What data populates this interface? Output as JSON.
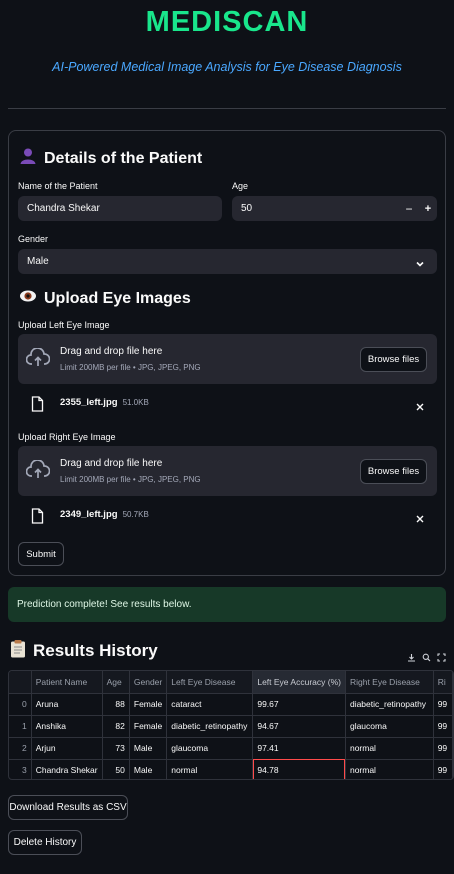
{
  "app": {
    "title": "MEDISCAN",
    "subtitle": "AI-Powered Medical Image Analysis for Eye Disease Diagnosis"
  },
  "patient": {
    "heading": "Details of the Patient",
    "name_label": "Name of the Patient",
    "name_value": "Chandra Shekar",
    "age_label": "Age",
    "age_value": "50",
    "age_minus": "−",
    "age_plus": "+",
    "gender_label": "Gender",
    "gender_value": "Male"
  },
  "upload": {
    "heading": "Upload Eye Images",
    "left_label": "Upload Left Eye Image",
    "right_label": "Upload Right Eye Image",
    "drag_text": "Drag and drop file here",
    "limit_text": "Limit 200MB per file • JPG, JPEG, PNG",
    "browse_label": "Browse files",
    "left_file": {
      "name": "2355_left.jpg",
      "size": "51.0KB"
    },
    "right_file": {
      "name": "2349_left.jpg",
      "size": "50.7KB"
    },
    "submit_label": "Submit"
  },
  "status": {
    "message": "Prediction complete! See results below."
  },
  "results": {
    "heading": "Results History",
    "columns": [
      "",
      "Patient Name",
      "Age",
      "Gender",
      "Left Eye Disease",
      "Left Eye Accuracy (%)",
      "Right Eye Disease",
      "Ri"
    ],
    "rows": [
      [
        "0",
        "Aruna",
        "88",
        "Female",
        "cataract",
        "99.67",
        "diabetic_retinopathy",
        "99"
      ],
      [
        "1",
        "Anshika",
        "82",
        "Female",
        "diabetic_retinopathy",
        "94.67",
        "glaucoma",
        "99"
      ],
      [
        "2",
        "Arjun",
        "73",
        "Male",
        "glaucoma",
        "97.41",
        "normal",
        "99"
      ],
      [
        "3",
        "Chandra Shekar",
        "50",
        "Male",
        "normal",
        "94.78",
        "normal",
        "99"
      ]
    ],
    "download_label": "Download Results as CSV",
    "delete_label": "Delete History"
  },
  "colors": {
    "title_green": "#19e68c",
    "subtitle_blue": "#4aa8ff",
    "background": "#0e1117",
    "widget_bg": "#262730",
    "success_bg": "#173928",
    "selection_red": "#ff4b4b"
  }
}
